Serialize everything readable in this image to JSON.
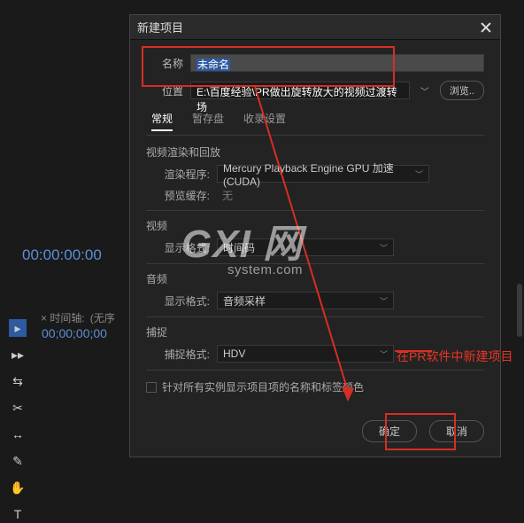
{
  "dialog": {
    "title": "新建项目",
    "name_label": "名称",
    "name_value": "未命名",
    "location_label": "位置",
    "location_value": "E:\\百度经验\\PR做出旋转放大的视频过渡转场",
    "browse_btn": "浏览..",
    "tabs": {
      "general": "常规",
      "scratch": "暂存盘",
      "ingest": "收录设置"
    },
    "sec_render": "视频渲染和回放",
    "renderer_label": "渲染程序:",
    "renderer_value": "Mercury Playback Engine GPU 加速 (CUDA)",
    "preview_cache_label": "预览缓存:",
    "preview_cache_value": "无",
    "sec_video": "视频",
    "display_format_label": "显示格式:",
    "display_format_value": "时间码",
    "sec_audio": "音频",
    "audio_format_label": "显示格式:",
    "audio_format_value": "音频采样",
    "sec_capture": "捕捉",
    "capture_format_label": "捕捉格式:",
    "capture_format_value": "HDV",
    "checkbox_label": "针对所有实例显示项目项的名称和标签颜色",
    "ok_btn": "确定",
    "cancel_btn": "取消"
  },
  "panel": {
    "timecode": "00:00:00:00",
    "seq_label": "时间轴",
    "seq_none": "(无序",
    "timecode_small": "00;00;00;00"
  },
  "annotation": {
    "text": "在PR软件中新建项目"
  },
  "watermark": {
    "big": "GXI 网",
    "small": "system.com"
  }
}
